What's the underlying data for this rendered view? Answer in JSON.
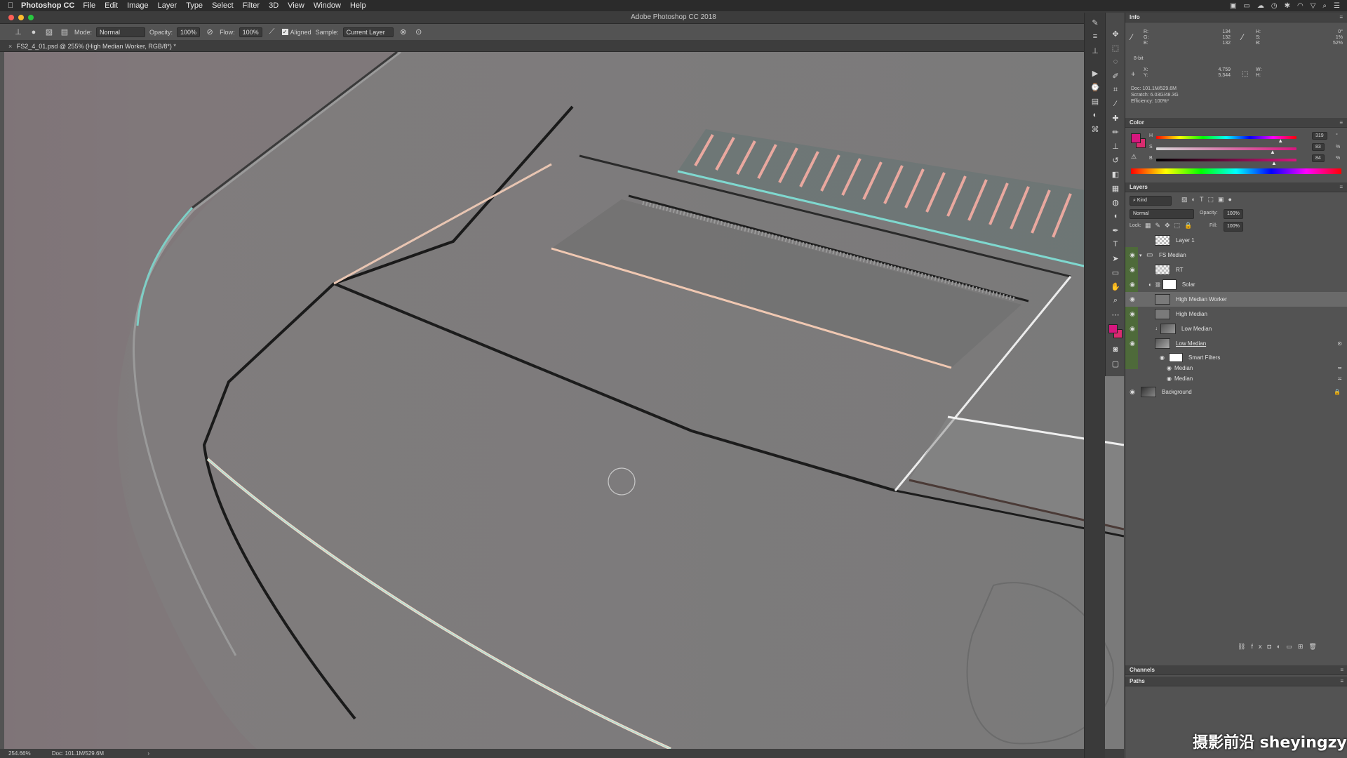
{
  "menubar": {
    "app_name": "Photoshop CC",
    "items": [
      "File",
      "Edit",
      "Image",
      "Layer",
      "Type",
      "Select",
      "Filter",
      "3D",
      "View",
      "Window",
      "Help"
    ]
  },
  "window": {
    "title": "Adobe Photoshop CC 2018"
  },
  "options": {
    "mode_label": "Mode:",
    "mode_value": "Normal",
    "opacity_label": "Opacity:",
    "opacity_value": "100%",
    "flow_label": "Flow:",
    "flow_value": "100%",
    "aligned_label": "Aligned",
    "sample_label": "Sample:",
    "sample_value": "Current Layer"
  },
  "document": {
    "tab_title": "FS2_4_01.psd @ 255% (High Median Worker, RGB/8*) *"
  },
  "status": {
    "zoom": "254.66%",
    "doc": "Doc: 101.1M/529.6M"
  },
  "info": {
    "title": "Info",
    "r_label": "R:",
    "g_label": "G:",
    "b_label": "B:",
    "r": "134",
    "g": "132",
    "b": "132",
    "h_label": "H:",
    "s_label": "S:",
    "b2_label": "B:",
    "h": "0°",
    "s": "1%",
    "b2": "52%",
    "bit": "8-bit",
    "x_label": "X:",
    "y_label": "Y:",
    "x": "4.759",
    "y": "5.344",
    "w_label": "W:",
    "h2_label": "H:",
    "doc": "Doc: 101.1M/529.6M",
    "scratch": "Scratch: 6.03G/48.3G",
    "efficiency": "Efficiency: 100%*"
  },
  "color": {
    "title": "Color",
    "h_label": "H",
    "s_label": "S",
    "b_label": "B",
    "h": "319",
    "s": "83",
    "b": "84",
    "unit_deg": "°",
    "unit_pct": "%",
    "foreground": "#d6167e",
    "background": "#d92c6f",
    "h_pos": 0.886,
    "s_pos": 0.83,
    "b_pos": 0.84
  },
  "layers": {
    "title": "Layers",
    "kind_label": "Kind",
    "blend_mode": "Normal",
    "opacity_label": "Opacity:",
    "opacity_value": "100%",
    "lock_label": "Lock:",
    "fill_label": "Fill:",
    "fill_value": "100%",
    "items": [
      {
        "name": "Layer 1",
        "visible": false
      },
      {
        "name": "FS Median",
        "visible": true
      },
      {
        "name": "RT",
        "visible": true
      },
      {
        "name": "Solar",
        "visible": true
      },
      {
        "name": "High Median Worker",
        "visible": true,
        "selected": true
      },
      {
        "name": "High Median",
        "visible": true
      },
      {
        "name": "Low Median",
        "visible": true
      },
      {
        "name": "Low Median",
        "visible": true
      },
      {
        "name": "Smart Filters",
        "visible": true
      },
      {
        "name": "Median",
        "visible": true
      },
      {
        "name": "Median",
        "visible": true
      },
      {
        "name": "Background",
        "visible": true
      }
    ]
  },
  "channels": {
    "title": "Channels"
  },
  "paths": {
    "title": "Paths"
  },
  "watermark": "摄影前沿 sheyingzyz.com"
}
